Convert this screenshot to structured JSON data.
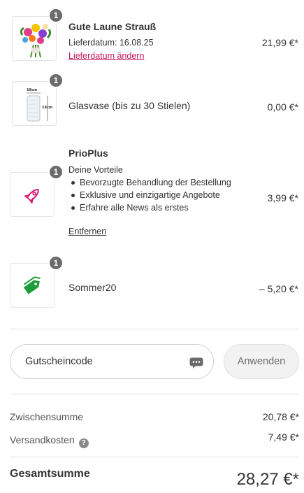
{
  "items": [
    {
      "qty": "1",
      "name": "Gute Laune Strauß",
      "delivery_label": "Lieferdatum: 16.08.25",
      "change_link": "Lieferdatum ändern",
      "price": "21,99 €*"
    },
    {
      "qty": "1",
      "name": "Glasvase (bis zu 30 Stielen)",
      "dim_top": "18cm",
      "dim_side": "18cm",
      "price": "0,00 €*"
    },
    {
      "qty": "1",
      "name": "PrioPlus",
      "benefits_title": "Deine Vorteile",
      "benefits": [
        "Bevorzugte Behandlung der Bestellung",
        "Exklusive und einzigartige Angebote",
        "Erfahre alle News als erstes"
      ],
      "remove_link": "Entfernen",
      "price": "3,99 €*",
      "icon": "rocket-icon",
      "icon_color": "#d81b74"
    },
    {
      "qty": "1",
      "name": "Sommer20",
      "price": "– 5,20 €*",
      "icon": "tag-icon",
      "icon_color": "#1e9e3a"
    }
  ],
  "coupon": {
    "placeholder": "Gutscheincode",
    "apply_label": "Anwenden"
  },
  "summary": {
    "subtotal_label": "Zwischensumme",
    "subtotal_value": "20,78 €*",
    "shipping_label": "Versandkosten",
    "shipping_help": "?",
    "shipping_value": "7,49 €*",
    "total_label": "Gesamtsumme",
    "total_value": "28,27 €*"
  },
  "colors": {
    "link_pink": "#c2185b",
    "badge_gray": "#6b6b6b"
  }
}
